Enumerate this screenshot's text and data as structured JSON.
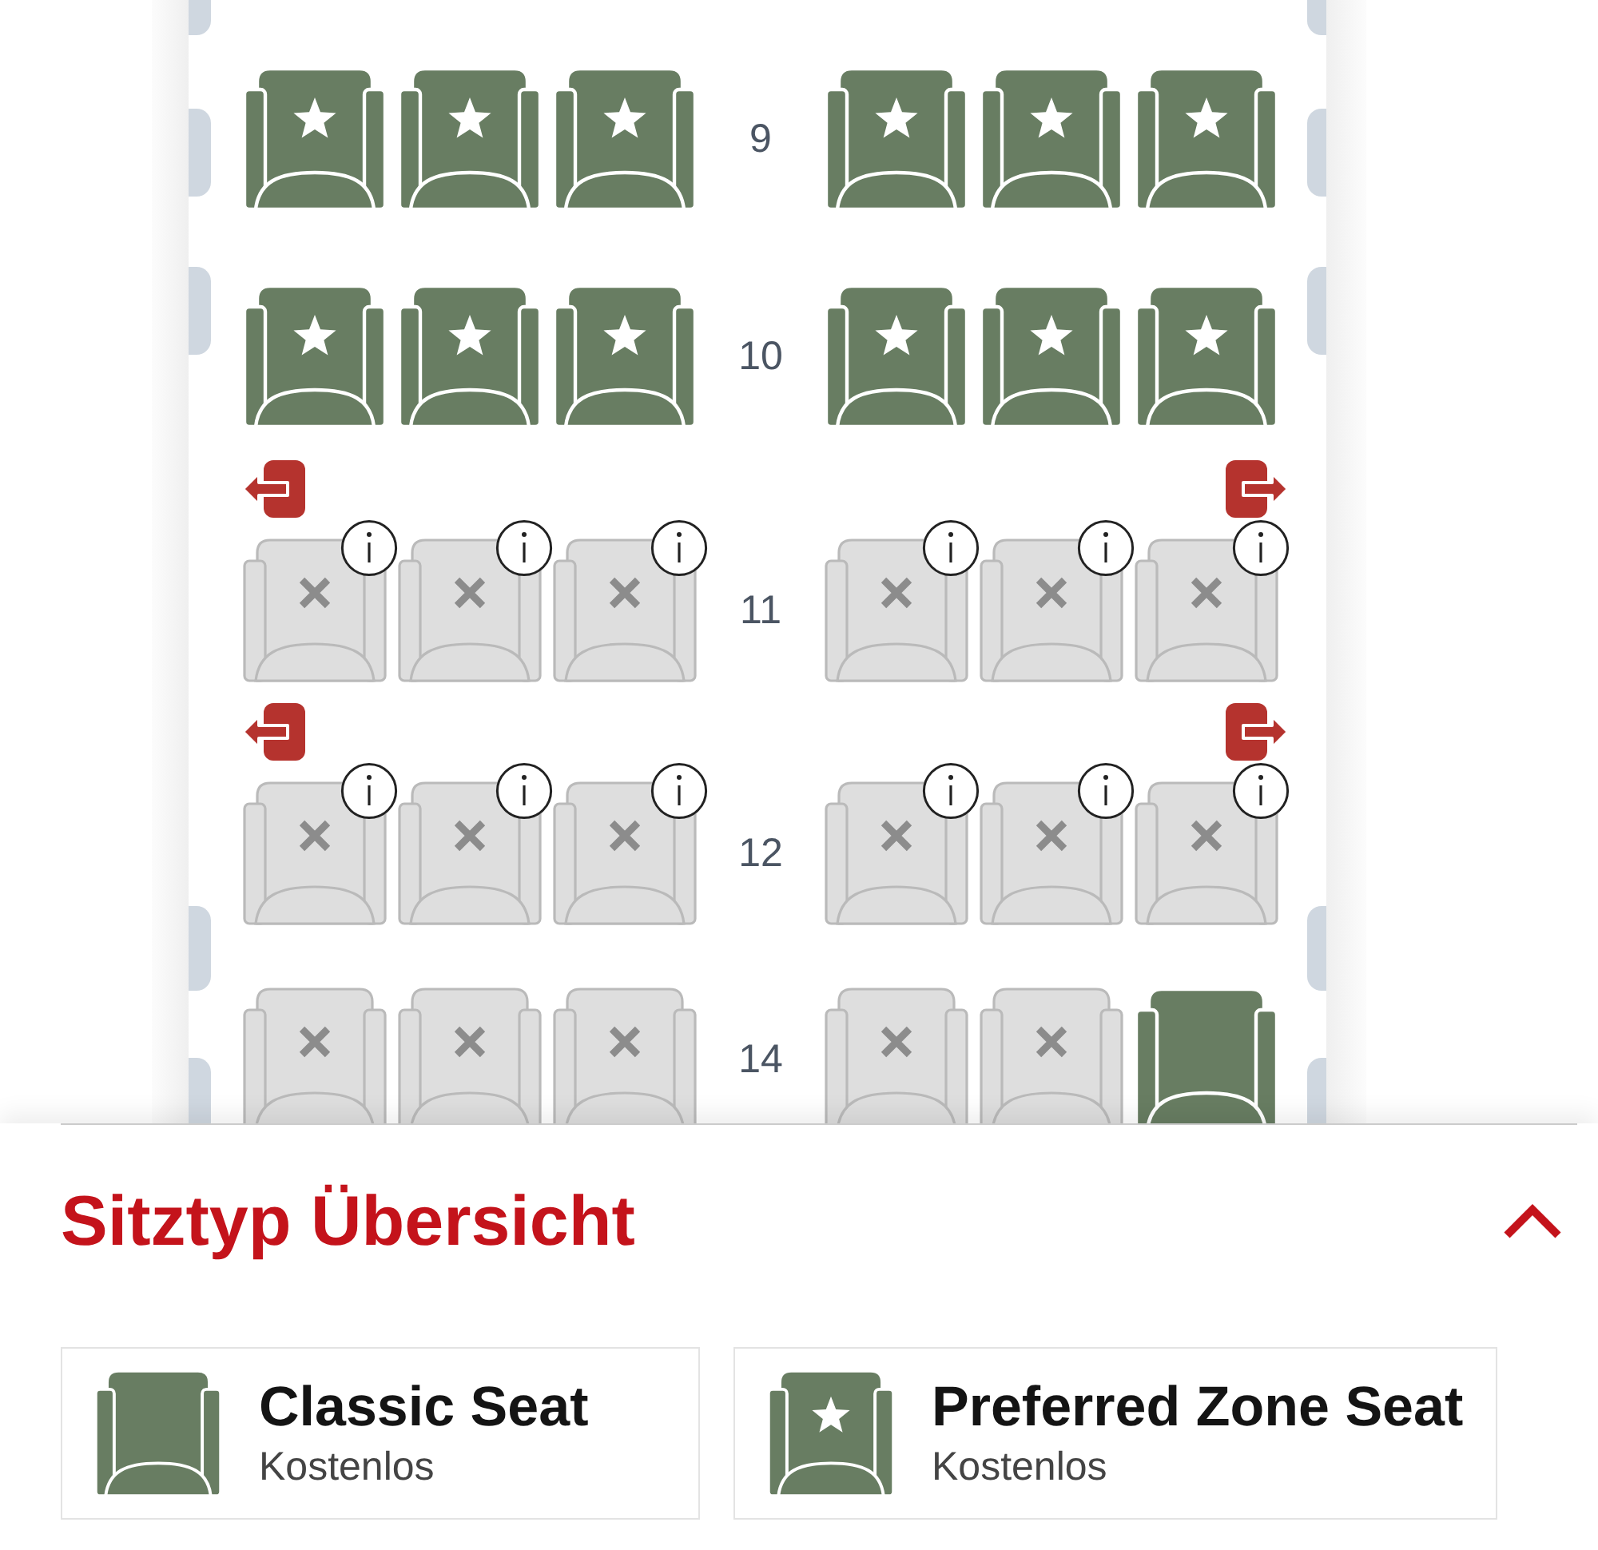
{
  "seat_map": {
    "rows": [
      {
        "number": "9",
        "exit": false,
        "left": [
          {
            "kind": "preferred",
            "info": false
          },
          {
            "kind": "preferred",
            "info": false
          },
          {
            "kind": "preferred",
            "info": false
          }
        ],
        "right": [
          {
            "kind": "preferred",
            "info": false
          },
          {
            "kind": "preferred",
            "info": false
          },
          {
            "kind": "preferred",
            "info": false
          }
        ]
      },
      {
        "number": "10",
        "exit": false,
        "left": [
          {
            "kind": "preferred",
            "info": false
          },
          {
            "kind": "preferred",
            "info": false
          },
          {
            "kind": "preferred",
            "info": false
          }
        ],
        "right": [
          {
            "kind": "preferred",
            "info": false
          },
          {
            "kind": "preferred",
            "info": false
          },
          {
            "kind": "preferred",
            "info": false
          }
        ]
      },
      {
        "number": "11",
        "exit": true,
        "left": [
          {
            "kind": "unavailable",
            "info": true
          },
          {
            "kind": "unavailable",
            "info": true
          },
          {
            "kind": "unavailable",
            "info": true
          }
        ],
        "right": [
          {
            "kind": "unavailable",
            "info": true
          },
          {
            "kind": "unavailable",
            "info": true
          },
          {
            "kind": "unavailable",
            "info": true
          }
        ]
      },
      {
        "number": "12",
        "exit": true,
        "left": [
          {
            "kind": "unavailable",
            "info": true
          },
          {
            "kind": "unavailable",
            "info": true
          },
          {
            "kind": "unavailable",
            "info": true
          }
        ],
        "right": [
          {
            "kind": "unavailable",
            "info": true
          },
          {
            "kind": "unavailable",
            "info": true
          },
          {
            "kind": "unavailable",
            "info": true
          }
        ]
      },
      {
        "number": "14",
        "exit": false,
        "left": [
          {
            "kind": "unavailable",
            "info": false
          },
          {
            "kind": "unavailable",
            "info": false
          },
          {
            "kind": "unavailable",
            "info": false
          }
        ],
        "right": [
          {
            "kind": "unavailable",
            "info": false
          },
          {
            "kind": "unavailable",
            "info": false
          },
          {
            "kind": "classic",
            "info": false
          }
        ]
      }
    ]
  },
  "legend": {
    "title": "Sitztyp Übersicht",
    "expanded": true,
    "items": [
      {
        "kind": "classic",
        "name": "Classic Seat",
        "price": "Kostenlos"
      },
      {
        "kind": "preferred",
        "name": "Preferred Zone Seat",
        "price": "Kostenlos"
      }
    ]
  }
}
